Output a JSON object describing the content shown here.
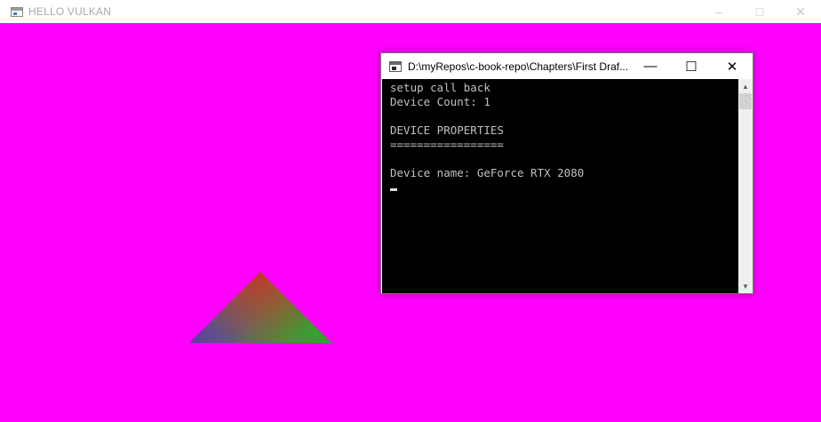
{
  "main_window": {
    "title": "HELLO VULKAN",
    "controls": {
      "minimize": "–",
      "maximize": "□",
      "close": "✕"
    },
    "background_color": "#ff00ff"
  },
  "console_window": {
    "title": "D:\\myRepos\\c-book-repo\\Chapters\\First Draf...",
    "controls": {
      "minimize": "—",
      "maximize": "☐",
      "close": "✕"
    },
    "lines": [
      "setup call back",
      "Device Count: 1",
      "",
      "DEVICE PROPERTIES",
      "=================",
      "",
      "Device name: GeForce RTX 2080"
    ]
  },
  "triangle": {
    "vertex_colors": {
      "top": "#c0392b",
      "left": "#5b3fa0",
      "right": "#2aa82a"
    }
  }
}
